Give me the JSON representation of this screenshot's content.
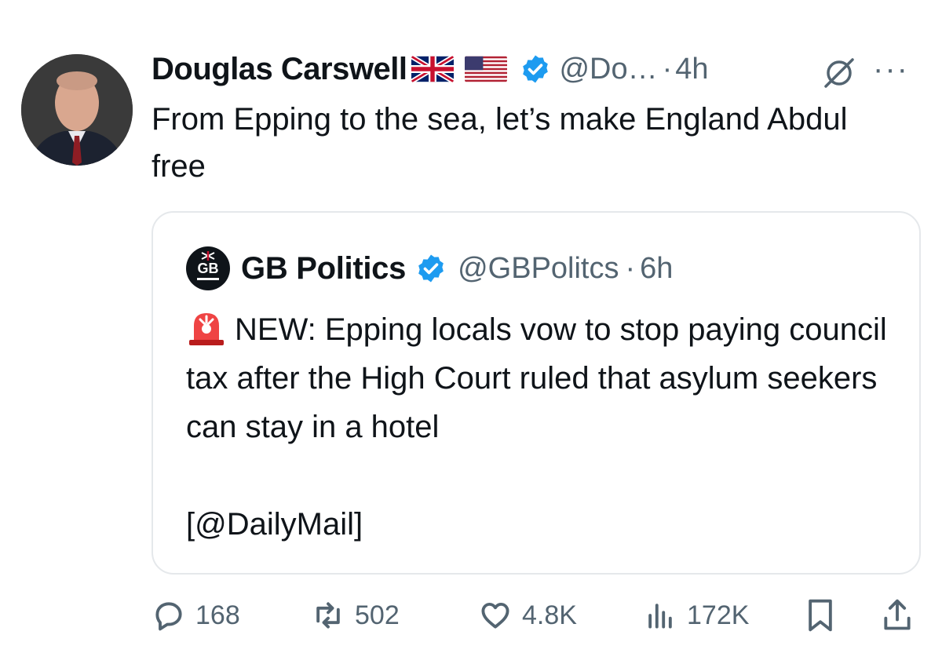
{
  "tweet": {
    "author_name": "Douglas Carswell",
    "handle": "@Do…",
    "separator": "·",
    "time": "4h",
    "text": "From Epping to the sea, let’s make England Abdul free",
    "flags": [
      "uk-flag-icon",
      "us-flag-icon"
    ]
  },
  "quoted": {
    "logo_text": "GB",
    "author_name": "GB Politics",
    "handle": "@GBPolitcs",
    "separator": "·",
    "time": "6h",
    "text": "NEW: Epping locals vow to stop paying council tax after the High Court ruled that asylum seekers can stay in a hotel\n\n[@DailyMail]",
    "emoji": "siren-icon"
  },
  "actions": {
    "replies": "168",
    "reposts": "502",
    "likes": "4.8K",
    "views": "172K"
  },
  "colors": {
    "verified": "#1d9bf0",
    "muted": "#536471",
    "border": "#e5e8eb"
  }
}
